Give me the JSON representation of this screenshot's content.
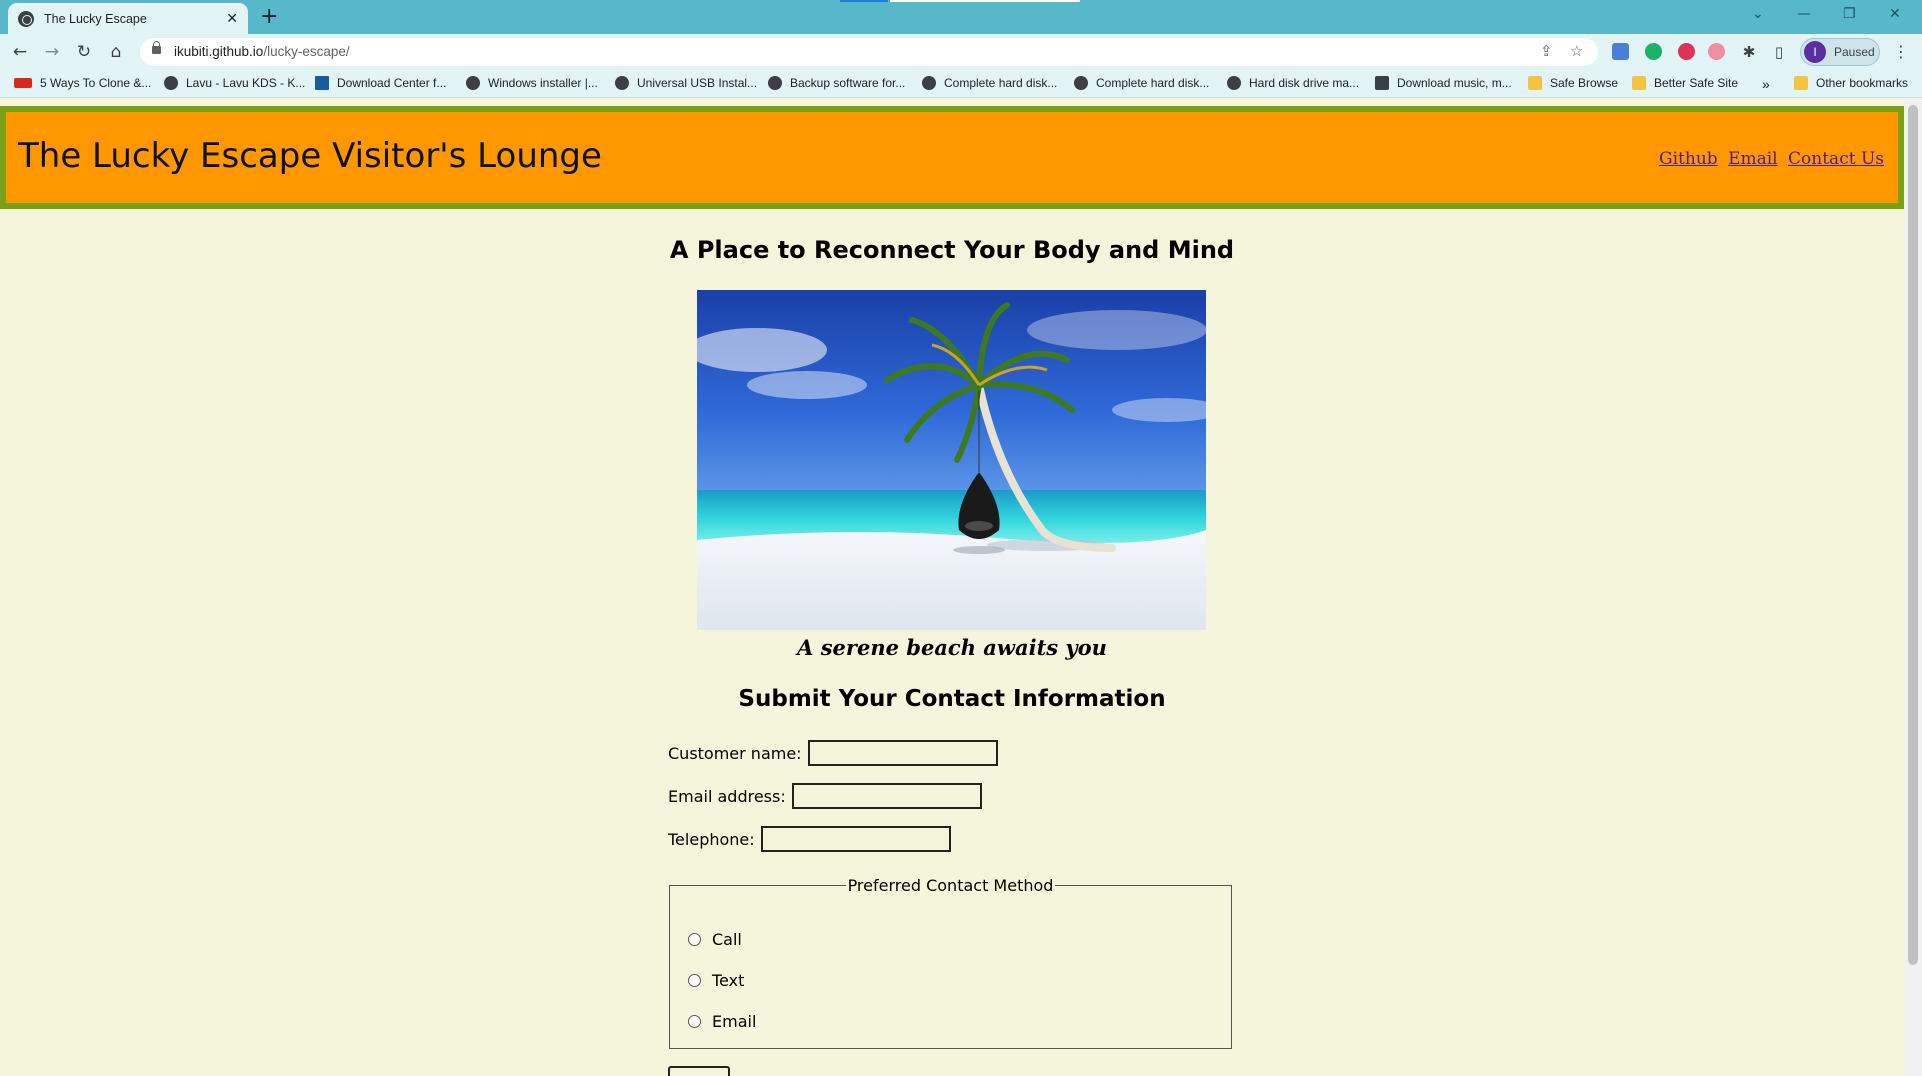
{
  "browser": {
    "tab_title": "The Lucky Escape",
    "close_glyph": "✕",
    "new_tab_glyph": "+",
    "url_host": "ikubiti.github.io",
    "url_path": "/lucky-escape/",
    "profile_initial": "I",
    "profile_status": "Paused",
    "window_controls": [
      "⌄",
      "—",
      "❐",
      "✕"
    ]
  },
  "bookmarks": [
    {
      "label": "5 Ways To Clone &...",
      "icon": "red-logo-icon"
    },
    {
      "label": "Lavu - Lavu KDS - K...",
      "icon": "globe-icon"
    },
    {
      "label": "Download Center f...",
      "icon": "vmware-icon"
    },
    {
      "label": "Windows installer |...",
      "icon": "globe-icon"
    },
    {
      "label": "Universal USB Instal...",
      "icon": "globe-icon"
    },
    {
      "label": "Backup software for...",
      "icon": "globe-icon"
    },
    {
      "label": "Complete hard disk...",
      "icon": "globe-icon"
    },
    {
      "label": "Complete hard disk...",
      "icon": "globe-icon"
    },
    {
      "label": "Hard disk drive ma...",
      "icon": "globe-icon"
    },
    {
      "label": "Download music, m...",
      "icon": "music-icon"
    },
    {
      "label": "Safe Browse",
      "icon": "folder-lock-icon"
    },
    {
      "label": "Better Safe Site",
      "icon": "folder-lock-icon"
    },
    {
      "label": "»",
      "icon": "more-icon"
    },
    {
      "label": "Other bookmarks",
      "icon": "folder-icon"
    }
  ],
  "site": {
    "title": "The Lucky Escape Visitor's Lounge",
    "nav": [
      "Github",
      "Email",
      "Contact Us"
    ],
    "subtitle": "A Place to Reconnect Your Body and Mind",
    "caption": "A serene beach awaits you",
    "form_title": "Submit Your Contact Information",
    "fields": [
      {
        "label": "Customer name:",
        "value": ""
      },
      {
        "label": "Email address:",
        "value": ""
      },
      {
        "label": "Telephone:",
        "value": ""
      }
    ],
    "fieldset_legend": "Preferred Contact Method",
    "contact_options": [
      "Call",
      "Text",
      "Email"
    ]
  },
  "colors": {
    "header_bg": "#ff9800",
    "header_border": "#7aa116",
    "page_bg": "#f5f5dc",
    "link": "#551a8b",
    "chrome_titlebar": "#56b8c9"
  }
}
